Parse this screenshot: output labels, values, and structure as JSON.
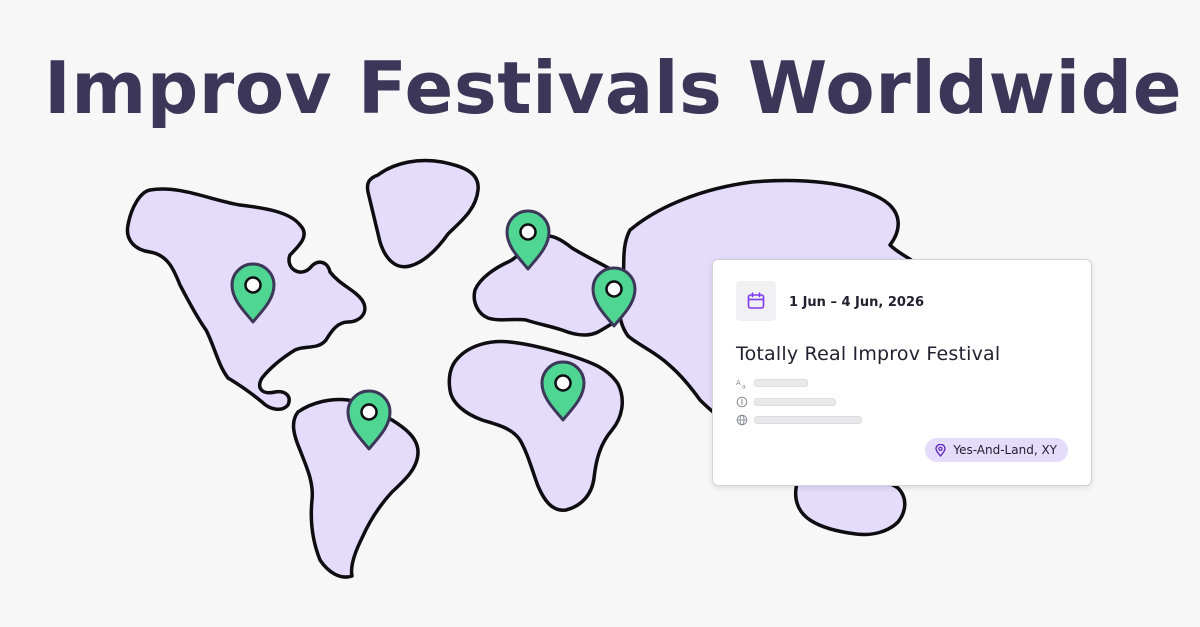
{
  "page": {
    "title": "Improv Festivals Worldwide"
  },
  "card": {
    "date": "1 Jun – 4 Jun, 2026",
    "name": "Totally Real Improv Festival",
    "location": "Yes-And-Land, XY",
    "meta_icons": [
      "translate-icon",
      "currency-icon",
      "globe-icon"
    ]
  },
  "map": {
    "pin_count": 5,
    "icons": [
      "map-pin-icon",
      "calendar-icon",
      "location-pin-icon"
    ]
  },
  "colors": {
    "background": "#f7f7f7",
    "title": "#3c3758",
    "land": "#e5dbfb",
    "pin": "#4fd693",
    "pin_outline": "#3c3758",
    "accent": "#7c3aed"
  }
}
